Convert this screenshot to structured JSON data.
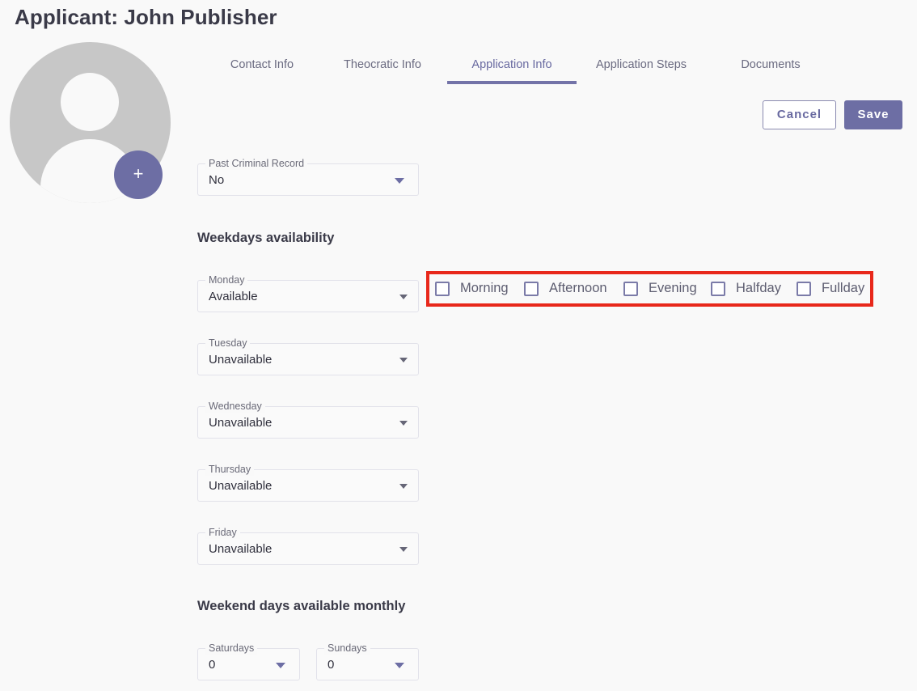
{
  "page": {
    "title": "Applicant: John Publisher"
  },
  "avatar": {
    "add_label": "+"
  },
  "tabs": [
    {
      "label": "Contact Info"
    },
    {
      "label": "Theocratic Info"
    },
    {
      "label": "Application Info"
    },
    {
      "label": "Application Steps"
    },
    {
      "label": "Documents"
    }
  ],
  "active_tab": "Application Info",
  "actions": {
    "cancel_label": "Cancel",
    "save_label": "Save"
  },
  "criminal": {
    "label": "Past Criminal Record",
    "value": "No"
  },
  "weekdays": {
    "title": "Weekdays availability",
    "days": [
      {
        "label": "Monday",
        "value": "Available"
      },
      {
        "label": "Tuesday",
        "value": "Unavailable"
      },
      {
        "label": "Wednesday",
        "value": "Unavailable"
      },
      {
        "label": "Thursday",
        "value": "Unavailable"
      },
      {
        "label": "Friday",
        "value": "Unavailable"
      }
    ],
    "time_slots": [
      {
        "label": "Morning",
        "checked": false
      },
      {
        "label": "Afternoon",
        "checked": false
      },
      {
        "label": "Evening",
        "checked": false
      },
      {
        "label": "Halfday",
        "checked": false
      },
      {
        "label": "Fullday",
        "checked": false
      }
    ]
  },
  "weekend": {
    "title": "Weekend days available monthly",
    "saturdays": {
      "label": "Saturdays",
      "value": "0"
    },
    "sundays": {
      "label": "Sundays",
      "value": "0"
    }
  },
  "colors": {
    "accent": "#6d6ea4",
    "highlight": "#e8281b"
  }
}
